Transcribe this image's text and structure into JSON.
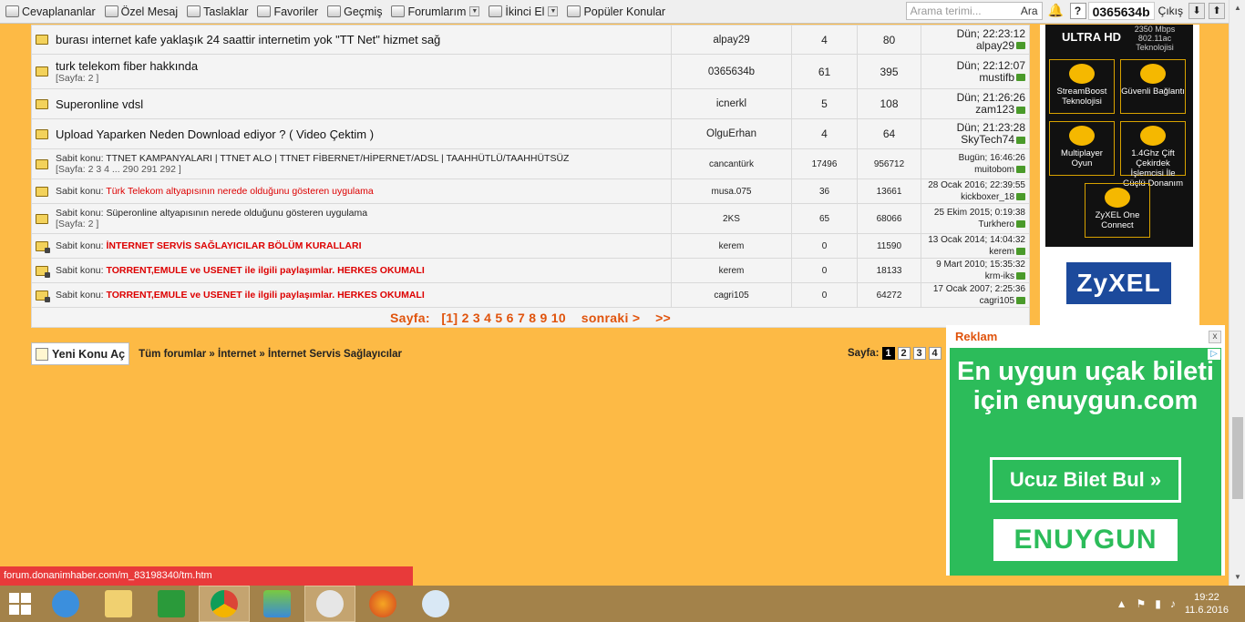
{
  "toolbar": {
    "items": [
      {
        "label": "Cevaplananlar"
      },
      {
        "label": "Özel Mesaj"
      },
      {
        "label": "Taslaklar"
      },
      {
        "label": "Favoriler"
      },
      {
        "label": "Geçmiş"
      },
      {
        "label": "Forumlarım"
      },
      {
        "label": "İkinci El"
      },
      {
        "label": "Popüler Konular"
      }
    ],
    "search_placeholder": "Arama terimi...",
    "search_button": "Ara",
    "help_label": "?",
    "username": "0365634b",
    "logout_label": "Çıkış",
    "down_arrow": "⬇",
    "up_arrow": "⬆"
  },
  "threads": [
    {
      "title": "burası internet kafe yaklaşık 24 saattir internetim yok \"TT Net\" hizmet sağ",
      "pages": "",
      "author": "alpay29",
      "replies": "4",
      "views": "80",
      "last_date": "Dün; 22:23:12",
      "last_user": "alpay29"
    },
    {
      "title": "turk telekom fiber hakkında",
      "pages": "[Sayfa: 2 ]",
      "author": "0365634b",
      "replies": "61",
      "views": "395",
      "last_date": "Dün; 22:12:07",
      "last_user": "mustifb"
    },
    {
      "title": "Superonline vdsl",
      "pages": "",
      "author": "icnerkl",
      "replies": "5",
      "views": "108",
      "last_date": "Dün; 21:26:26",
      "last_user": "zam123"
    },
    {
      "title": "Upload Yaparken Neden Download ediyor ? ( Video Çektim )",
      "pages": "",
      "author": "OlguErhan",
      "replies": "4",
      "views": "64",
      "last_date": "Dün; 21:23:28",
      "last_user": "SkyTech74"
    }
  ],
  "sticky_label": "Sabit konu:",
  "stickies": [
    {
      "title": "TTNET KAMPANYALARI | TTNET ALO | TTNET FİBERNET/HİPERNET/ADSL | TAAHHÜTLÜ/TAAHHÜTSÜZ",
      "pages": "[Sayfa: 2 3 4 ... 290 291 292 ]",
      "author": "cancantürk",
      "replies": "17496",
      "views": "956712",
      "last_date": "Bugün; 16:46:26",
      "last_user": "muitobom"
    },
    {
      "title": "Türk Telekom altyapısının nerede olduğunu gösteren uygulama",
      "pages": "",
      "author": "musa.075",
      "replies": "36",
      "views": "13661",
      "last_date": "28 Ocak 2016; 22:39:55",
      "last_user": "kickboxer_18"
    },
    {
      "title": "Süperonline altyapısının nerede olduğunu gösteren uygulama",
      "pages": "[Sayfa: 2 ]",
      "author": "2KS",
      "replies": "65",
      "views": "68066",
      "last_date": "25 Ekim 2015; 0:19:38",
      "last_user": "Turkhero"
    },
    {
      "title": "İNTERNET SERVİS SAĞLAYICILAR BÖLÜM KURALLARI",
      "pages": "",
      "author": "kerem",
      "replies": "0",
      "views": "11590",
      "last_date": "13 Ocak 2014; 14:04:32",
      "last_user": "kerem"
    },
    {
      "title": "TORRENT,EMULE ve USENET ile ilgili paylaşımlar. HERKES OKUMALI",
      "pages": "",
      "author": "kerem",
      "replies": "0",
      "views": "18133",
      "last_date": "9 Mart 2010; 15:35:32",
      "last_user": "krm-iks"
    },
    {
      "title": "TORRENT,EMULE ve USENET ile ilgili paylaşımlar. HERKES OKUMALI",
      "pages": "",
      "author": "cagri105",
      "replies": "0",
      "views": "64272",
      "last_date": "17 Ocak 2007; 2:25:36",
      "last_user": "cagri105"
    }
  ],
  "pager": {
    "label": "Sayfa:",
    "pages": "[1] 2 3 4 5 6 7 8 9 10",
    "next": "sonraki >",
    "last": ">>"
  },
  "bottom": {
    "new_topic": "Yeni Konu Aç",
    "breadcrumb": "Tüm forumlar » İnternet » İnternet Servis Sağlayıcılar",
    "page_label": "Sayfa:",
    "pages": [
      "1",
      "2",
      "3",
      "4"
    ]
  },
  "sidebar_ad": {
    "ultra": "ULTRA HD",
    "mbps": "2350 Mbps 802.11ac Teknolojisi",
    "tiles": [
      "StreamBoost Teknolojisi",
      "Güvenli Bağlantı",
      "Multiplayer Oyun",
      "1.4Ghz Çift Çekirdek İşlemcisi İle Güçlü Donanım",
      "ZyXEL One Connect"
    ],
    "logo": "ZyXEL"
  },
  "ad": {
    "title": "Reklam",
    "close": "x",
    "headline": "En uygun uçak bileti için enuygun.com",
    "button": "Ucuz Bilet Bul »",
    "logo": "ENUYGUN"
  },
  "status_url": "forum.donanimhaber.com/m_83198340/tm.htm",
  "clock": {
    "time": "19:22",
    "date": "11.6.2016"
  },
  "colors": {
    "bg": "#fdba45",
    "accent": "#e0530c",
    "sticky_red": "#dd0000",
    "ad_green": "#2cbc5a"
  }
}
